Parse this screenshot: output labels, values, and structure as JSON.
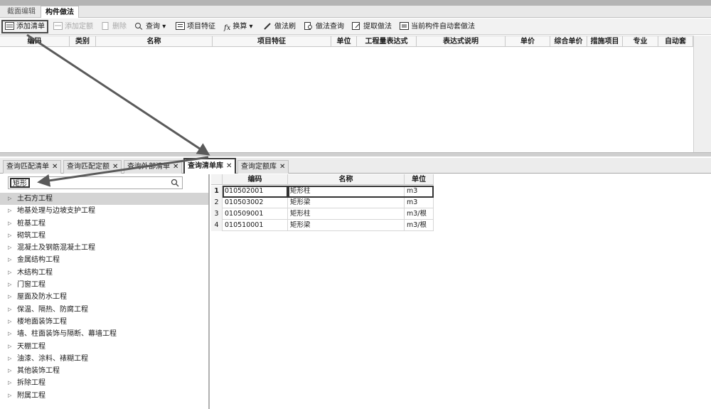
{
  "top_tabs": [
    "截面编辑",
    "构件做法"
  ],
  "toolbar": {
    "add_list": "添加清单",
    "add_quota": "添加定额",
    "delete": "删除",
    "query": "查询",
    "item_feature": "项目特征",
    "convert": "换算",
    "method_brush": "做法刷",
    "method_query": "做法查询",
    "extract_method": "提取做法",
    "auto_apply": "当前构件自动套做法"
  },
  "grid_headers": [
    "编码",
    "类别",
    "名称",
    "项目特征",
    "单位",
    "工程量表达式",
    "表达式说明",
    "单价",
    "综合单价",
    "措施项目",
    "专业",
    "自动套"
  ],
  "panel_tabs": [
    "查询匹配清单",
    "查询匹配定额",
    "查询外部清单",
    "查询清单库",
    "查询定额库"
  ],
  "search": {
    "value": "矩形"
  },
  "tree_items": [
    "土石方工程",
    "地基处理与边坡支护工程",
    "桩基工程",
    "砌筑工程",
    "混凝土及钢筋混凝土工程",
    "金属结构工程",
    "木结构工程",
    "门窗工程",
    "屋面及防水工程",
    "保温、隔热、防腐工程",
    "楼地面装饰工程",
    "墙、柱面装饰与隔断、幕墙工程",
    "天棚工程",
    "油漆、涂料、裱糊工程",
    "其他装饰工程",
    "拆除工程",
    "附属工程"
  ],
  "result_headers": {
    "code": "编码",
    "name": "名称",
    "unit": "单位"
  },
  "results": [
    {
      "n": "1",
      "code": "010502001",
      "name": "矩形柱",
      "unit": "m3"
    },
    {
      "n": "2",
      "code": "010503002",
      "name": "矩形梁",
      "unit": "m3"
    },
    {
      "n": "3",
      "code": "010509001",
      "name": "矩形柱",
      "unit": "m3/根"
    },
    {
      "n": "4",
      "code": "010510001",
      "name": "矩形梁",
      "unit": "m3/根"
    }
  ],
  "close_glyph": "✕",
  "colors": {
    "highlight_box": "#333333",
    "selected_row": "#d4d4d4"
  }
}
